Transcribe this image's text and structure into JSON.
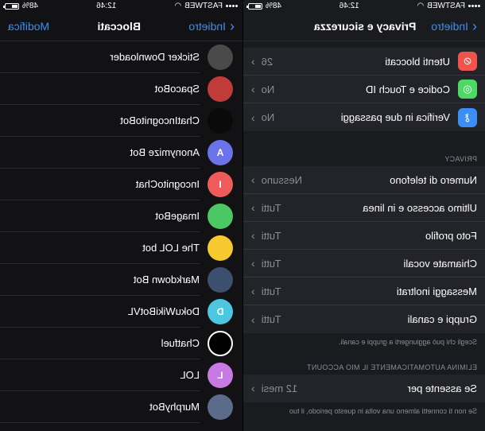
{
  "status": {
    "battery": "48%",
    "time": "12:46",
    "carrier": "FASTWEB"
  },
  "privacy": {
    "back_label": "Indietro",
    "title": "Privacy e sicurezza",
    "top_rows": [
      {
        "label": "Utenti bloccati",
        "value": "26",
        "icon": "block-icon",
        "color": "#f0534b"
      },
      {
        "label": "Codice e Touch ID",
        "value": "No",
        "icon": "fingerprint-icon",
        "color": "#4cd964"
      },
      {
        "label": "Verifica in due passaggi",
        "value": "No",
        "icon": "key-icon",
        "color": "#3a8ef6"
      }
    ],
    "privacy_header": "PRIVACY",
    "privacy_rows": [
      {
        "label": "Numero di telefono",
        "value": "Nessuno"
      },
      {
        "label": "Ultimo accesso e in linea",
        "value": "Tutti"
      },
      {
        "label": "Foto profilo",
        "value": "Tutti"
      },
      {
        "label": "Chiamate vocali",
        "value": "Tutti"
      },
      {
        "label": "Messaggi inoltrati",
        "value": "Tutti"
      },
      {
        "label": "Gruppi e canali",
        "value": "Tutti"
      }
    ],
    "groups_note": "Scegli chi può aggiungerti a gruppi e canali.",
    "autodelete_header": "ELIMINA AUTOMATICAMENTE IL MIO ACCOUNT",
    "autodelete_row": {
      "label": "Se assente per",
      "value": "12 mesi"
    },
    "autodelete_note": "Se non ti connetti almeno una volta in questo periodo, il tuo"
  },
  "blocked": {
    "back_label": "Indietro",
    "title": "Bloccati",
    "edit_label": "Modifica",
    "items": [
      {
        "name": "Sticker Downloader",
        "initial": "",
        "color": "#4a4a4a"
      },
      {
        "name": "SpacoBot",
        "initial": "",
        "color": "#c23b3b"
      },
      {
        "name": "ChatIncognitoBot",
        "initial": "",
        "color": "#0a0a0a"
      },
      {
        "name": "Anonymize Bot",
        "initial": "A",
        "color": "#6a73e8"
      },
      {
        "name": "IncognitoChat",
        "initial": "I",
        "color": "#ef5a5a"
      },
      {
        "name": "ImageBot",
        "initial": "",
        "color": "#4bc764"
      },
      {
        "name": "The LOL bot",
        "initial": "",
        "color": "#f6c92e"
      },
      {
        "name": "Markdown Bot",
        "initial": "",
        "color": "#3c4f6e"
      },
      {
        "name": "DokuWikiBotVL",
        "initial": "D",
        "color": "#4dc7e0"
      },
      {
        "name": "Chatfuel",
        "initial": "",
        "color": "#000000"
      },
      {
        "name": "LOL",
        "initial": "L",
        "color": "#c77ae3"
      },
      {
        "name": "MurphyBot",
        "initial": "",
        "color": "#5a6c8a"
      }
    ]
  }
}
